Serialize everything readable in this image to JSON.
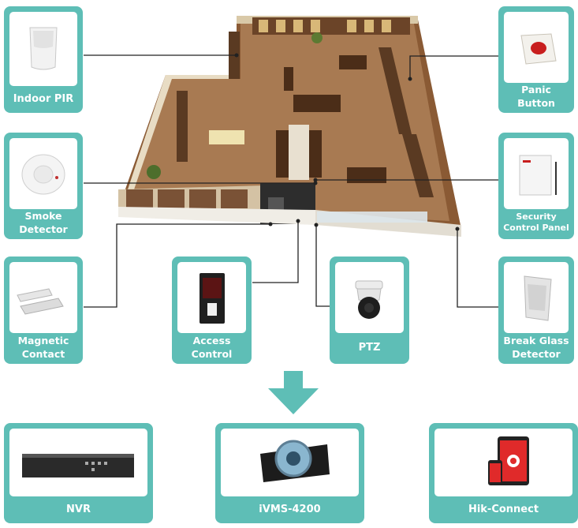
{
  "devices": {
    "indoor_pir": {
      "line1": "Indoor PIR"
    },
    "panic_button": {
      "line1": "Panic",
      "line2": "Button"
    },
    "smoke_detector": {
      "line1": "Smoke",
      "line2": "Detector"
    },
    "security_control_panel": {
      "line1": "Security",
      "line2": "Control Panel"
    },
    "magnetic_contact": {
      "line1": "Magnetic",
      "line2": "Contact"
    },
    "access_control": {
      "line1": "Access",
      "line2": "Control"
    },
    "ptz": {
      "line1": "PTZ"
    },
    "break_glass_detector": {
      "line1": "Break Glass",
      "line2": "Detector"
    }
  },
  "systems": {
    "nvr": {
      "label": "NVR"
    },
    "ivms": {
      "label": "iVMS-4200"
    },
    "hik_connect": {
      "label": "Hik-Connect"
    }
  },
  "colors": {
    "accent": "#5ebeb6",
    "line": "#222222"
  }
}
